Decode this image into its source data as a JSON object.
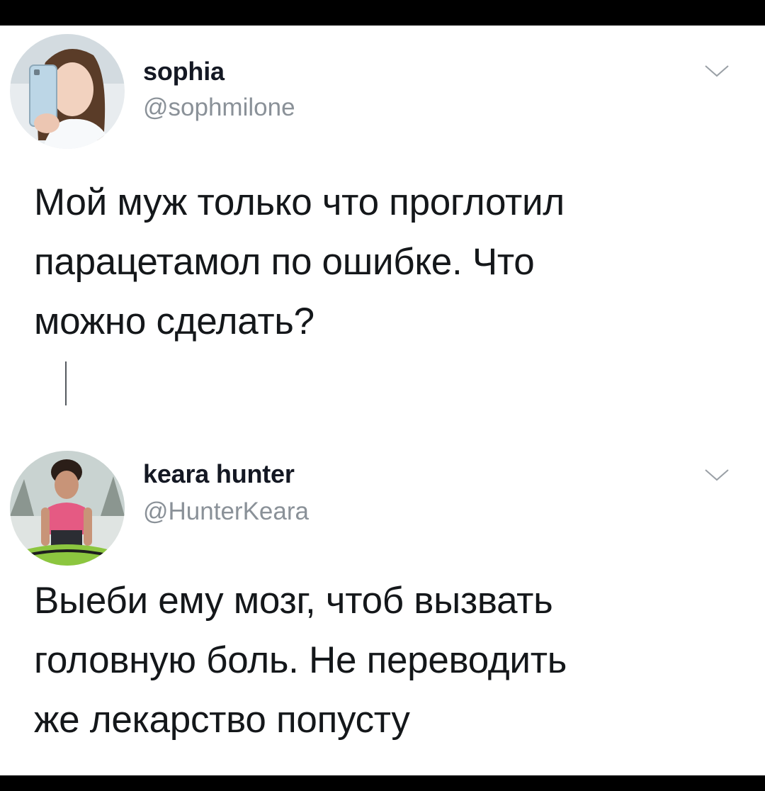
{
  "tweets": [
    {
      "display_name": "sophia",
      "handle": "@sophmilone",
      "text_lines": [
        "Мой муж только что проглотил",
        "парацетамол по ошибке. Что",
        "можно сделать?"
      ],
      "menu_icon": "chevron-down-icon"
    },
    {
      "display_name": "keara hunter",
      "handle": "@HunterKeara",
      "text_lines": [
        "Выеби ему мозг, чтоб вызвать",
        "головную боль. Не переводить",
        "же лекарство попусту"
      ],
      "menu_icon": "chevron-down-icon"
    }
  ],
  "colors": {
    "background": "#000000",
    "card": "#ffffff",
    "text": "#14171a",
    "handle": "#8a9198",
    "chevron": "#9aa0a6"
  }
}
